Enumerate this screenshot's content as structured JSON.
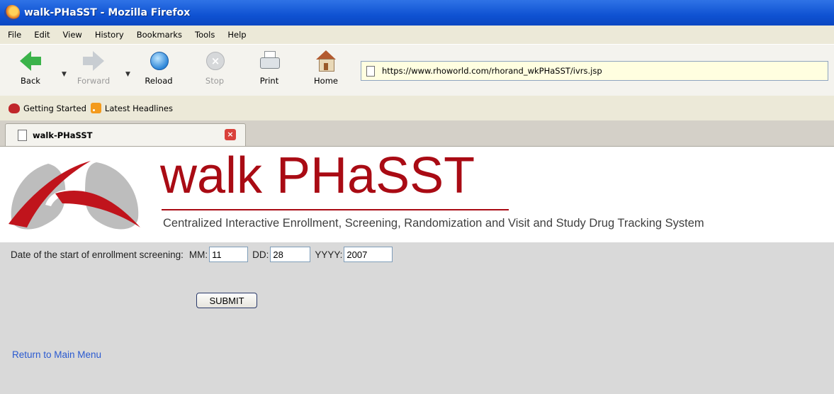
{
  "window": {
    "title": "walk-PHaSST - Mozilla Firefox"
  },
  "menu": [
    "File",
    "Edit",
    "View",
    "History",
    "Bookmarks",
    "Tools",
    "Help"
  ],
  "toolbar": {
    "back": "Back",
    "forward": "Forward",
    "reload": "Reload",
    "stop": "Stop",
    "print": "Print",
    "home": "Home",
    "url": "https://www.rhoworld.com/rhorand_wkPHaSST/ivrs.jsp"
  },
  "bookmarks": [
    "Getting Started",
    "Latest Headlines"
  ],
  "tab": {
    "title": "walk-PHaSST"
  },
  "page": {
    "brand_title": "walk PHaSST",
    "brand_subtitle": "Centralized Interactive Enrollment, Screening, Randomization and Visit and Study Drug Tracking System",
    "date_label": "Date of the start of enrollment screening:",
    "mm_label": "MM:",
    "mm_value": "11",
    "dd_label": "DD:",
    "dd_value": "28",
    "yyyy_label": "YYYY:",
    "yyyy_value": "2007",
    "submit_label": "SUBMIT",
    "return_link": "Return to Main Menu"
  },
  "colors": {
    "brand_red": "#a90b14",
    "link_blue": "#2a5ad0",
    "titlebar_blue": "#0f52d2",
    "page_bg": "#d9d9d9"
  },
  "icons": [
    "firefox-icon",
    "back-arrow-icon",
    "forward-arrow-icon",
    "reload-icon",
    "stop-icon",
    "print-icon",
    "home-icon",
    "page-icon",
    "getting-started-icon",
    "rss-icon",
    "tab-close-icon",
    "lungs-logo-icon"
  ]
}
